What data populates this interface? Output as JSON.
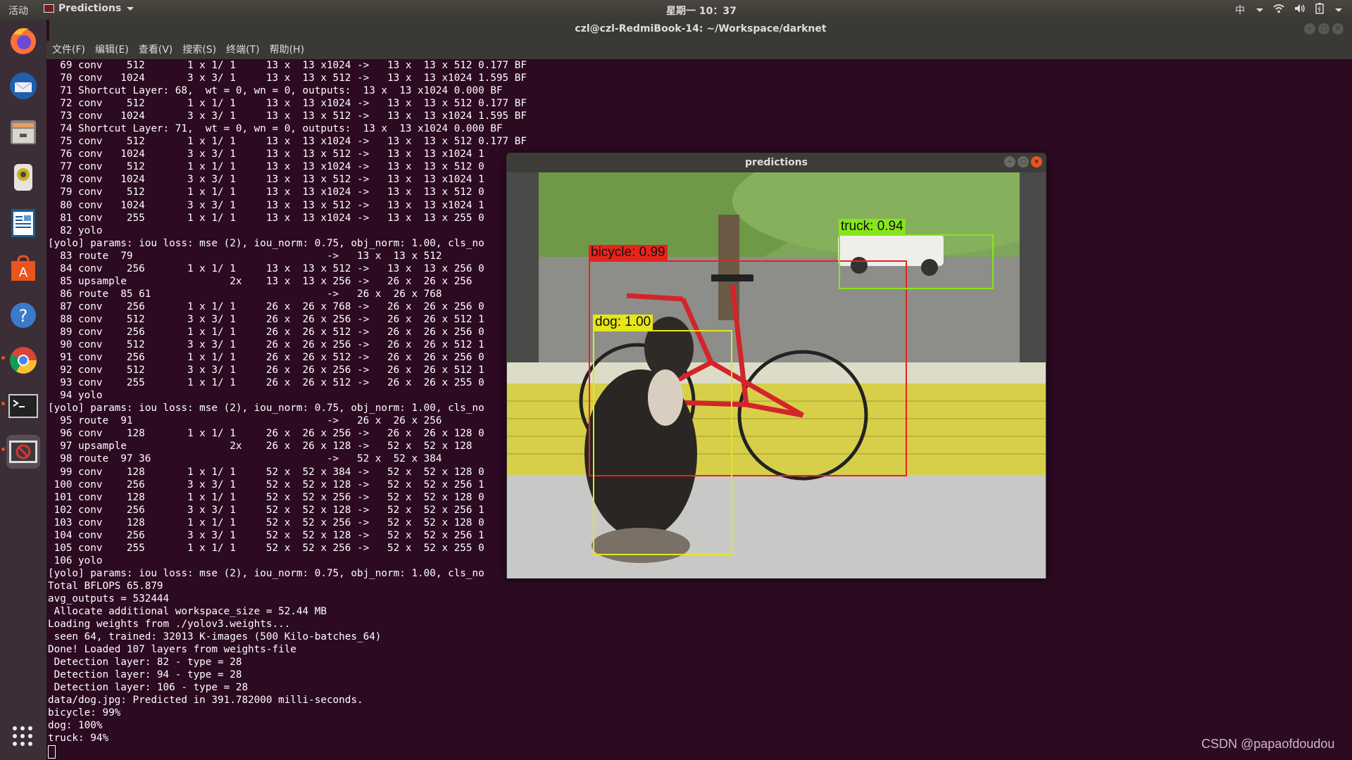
{
  "topbar": {
    "activities": "活动",
    "app_name": "Predictions",
    "clock": "星期一 10：37",
    "tray": {
      "input_method": "中",
      "icons": [
        "wifi-icon",
        "volume-icon",
        "battery-icon",
        "system-menu-icon"
      ]
    }
  },
  "terminal": {
    "title": "czl@czl-RedmiBook-14: ~/Workspace/darknet",
    "menu": [
      "文件(F)",
      "编辑(E)",
      "查看(V)",
      "搜索(S)",
      "终端(T)",
      "帮助(H)"
    ],
    "lines": [
      "  69 conv    512       1 x 1/ 1     13 x  13 x1024 ->   13 x  13 x 512 0.177 BF",
      "  70 conv   1024       3 x 3/ 1     13 x  13 x 512 ->   13 x  13 x1024 1.595 BF",
      "  71 Shortcut Layer: 68,  wt = 0, wn = 0, outputs:  13 x  13 x1024 0.000 BF",
      "  72 conv    512       1 x 1/ 1     13 x  13 x1024 ->   13 x  13 x 512 0.177 BF",
      "  73 conv   1024       3 x 3/ 1     13 x  13 x 512 ->   13 x  13 x1024 1.595 BF",
      "  74 Shortcut Layer: 71,  wt = 0, wn = 0, outputs:  13 x  13 x1024 0.000 BF",
      "  75 conv    512       1 x 1/ 1     13 x  13 x1024 ->   13 x  13 x 512 0.177 BF",
      "  76 conv   1024       3 x 3/ 1     13 x  13 x 512 ->   13 x  13 x1024 1",
      "  77 conv    512       1 x 1/ 1     13 x  13 x1024 ->   13 x  13 x 512 0",
      "  78 conv   1024       3 x 3/ 1     13 x  13 x 512 ->   13 x  13 x1024 1",
      "  79 conv    512       1 x 1/ 1     13 x  13 x1024 ->   13 x  13 x 512 0",
      "  80 conv   1024       3 x 3/ 1     13 x  13 x 512 ->   13 x  13 x1024 1",
      "  81 conv    255       1 x 1/ 1     13 x  13 x1024 ->   13 x  13 x 255 0",
      "  82 yolo",
      "[yolo] params: iou loss: mse (2), iou_norm: 0.75, obj_norm: 1.00, cls_no",
      "  83 route  79                                ->   13 x  13 x 512",
      "  84 conv    256       1 x 1/ 1     13 x  13 x 512 ->   13 x  13 x 256 0",
      "  85 upsample                 2x    13 x  13 x 256 ->   26 x  26 x 256",
      "  86 route  85 61                             ->   26 x  26 x 768",
      "  87 conv    256       1 x 1/ 1     26 x  26 x 768 ->   26 x  26 x 256 0",
      "  88 conv    512       3 x 3/ 1     26 x  26 x 256 ->   26 x  26 x 512 1",
      "  89 conv    256       1 x 1/ 1     26 x  26 x 512 ->   26 x  26 x 256 0",
      "  90 conv    512       3 x 3/ 1     26 x  26 x 256 ->   26 x  26 x 512 1",
      "  91 conv    256       1 x 1/ 1     26 x  26 x 512 ->   26 x  26 x 256 0",
      "  92 conv    512       3 x 3/ 1     26 x  26 x 256 ->   26 x  26 x 512 1",
      "  93 conv    255       1 x 1/ 1     26 x  26 x 512 ->   26 x  26 x 255 0",
      "  94 yolo",
      "[yolo] params: iou loss: mse (2), iou_norm: 0.75, obj_norm: 1.00, cls_no",
      "  95 route  91                                ->   26 x  26 x 256",
      "  96 conv    128       1 x 1/ 1     26 x  26 x 256 ->   26 x  26 x 128 0",
      "  97 upsample                 2x    26 x  26 x 128 ->   52 x  52 x 128",
      "  98 route  97 36                             ->   52 x  52 x 384",
      "  99 conv    128       1 x 1/ 1     52 x  52 x 384 ->   52 x  52 x 128 0",
      " 100 conv    256       3 x 3/ 1     52 x  52 x 128 ->   52 x  52 x 256 1",
      " 101 conv    128       1 x 1/ 1     52 x  52 x 256 ->   52 x  52 x 128 0",
      " 102 conv    256       3 x 3/ 1     52 x  52 x 128 ->   52 x  52 x 256 1",
      " 103 conv    128       1 x 1/ 1     52 x  52 x 256 ->   52 x  52 x 128 0",
      " 104 conv    256       3 x 3/ 1     52 x  52 x 128 ->   52 x  52 x 256 1",
      " 105 conv    255       1 x 1/ 1     52 x  52 x 256 ->   52 x  52 x 255 0",
      " 106 yolo",
      "[yolo] params: iou loss: mse (2), iou_norm: 0.75, obj_norm: 1.00, cls_no",
      "Total BFLOPS 65.879",
      "avg_outputs = 532444",
      " Allocate additional workspace_size = 52.44 MB",
      "Loading weights from ./yolov3.weights...",
      " seen 64, trained: 32013 K-images (500 Kilo-batches_64)",
      "Done! Loaded 107 layers from weights-file",
      " Detection layer: 82 - type = 28",
      " Detection layer: 94 - type = 28",
      " Detection layer: 106 - type = 28",
      "data/dog.jpg: Predicted in 391.782000 milli-seconds.",
      "bicycle: 99%",
      "dog: 100%",
      "truck: 94%"
    ]
  },
  "dock": {
    "apps": [
      {
        "name": "firefox",
        "running": false
      },
      {
        "name": "thunderbird",
        "running": false
      },
      {
        "name": "files",
        "running": false
      },
      {
        "name": "rhythmbox",
        "running": false
      },
      {
        "name": "libreoffice-writer",
        "running": false
      },
      {
        "name": "ubuntu-software",
        "running": false
      },
      {
        "name": "help",
        "running": false
      },
      {
        "name": "chrome",
        "running": true
      },
      {
        "name": "terminal",
        "running": true
      },
      {
        "name": "predictions",
        "running": true
      }
    ]
  },
  "predictions_window": {
    "title": "predictions",
    "detections": [
      {
        "label": "bicycle: 0.99",
        "color": "#e8231c"
      },
      {
        "label": "dog: 1.00",
        "color": "#e6e619"
      },
      {
        "label": "truck: 0.94",
        "color": "#86e619"
      }
    ]
  },
  "watermark": "CSDN @papaofdoudou"
}
